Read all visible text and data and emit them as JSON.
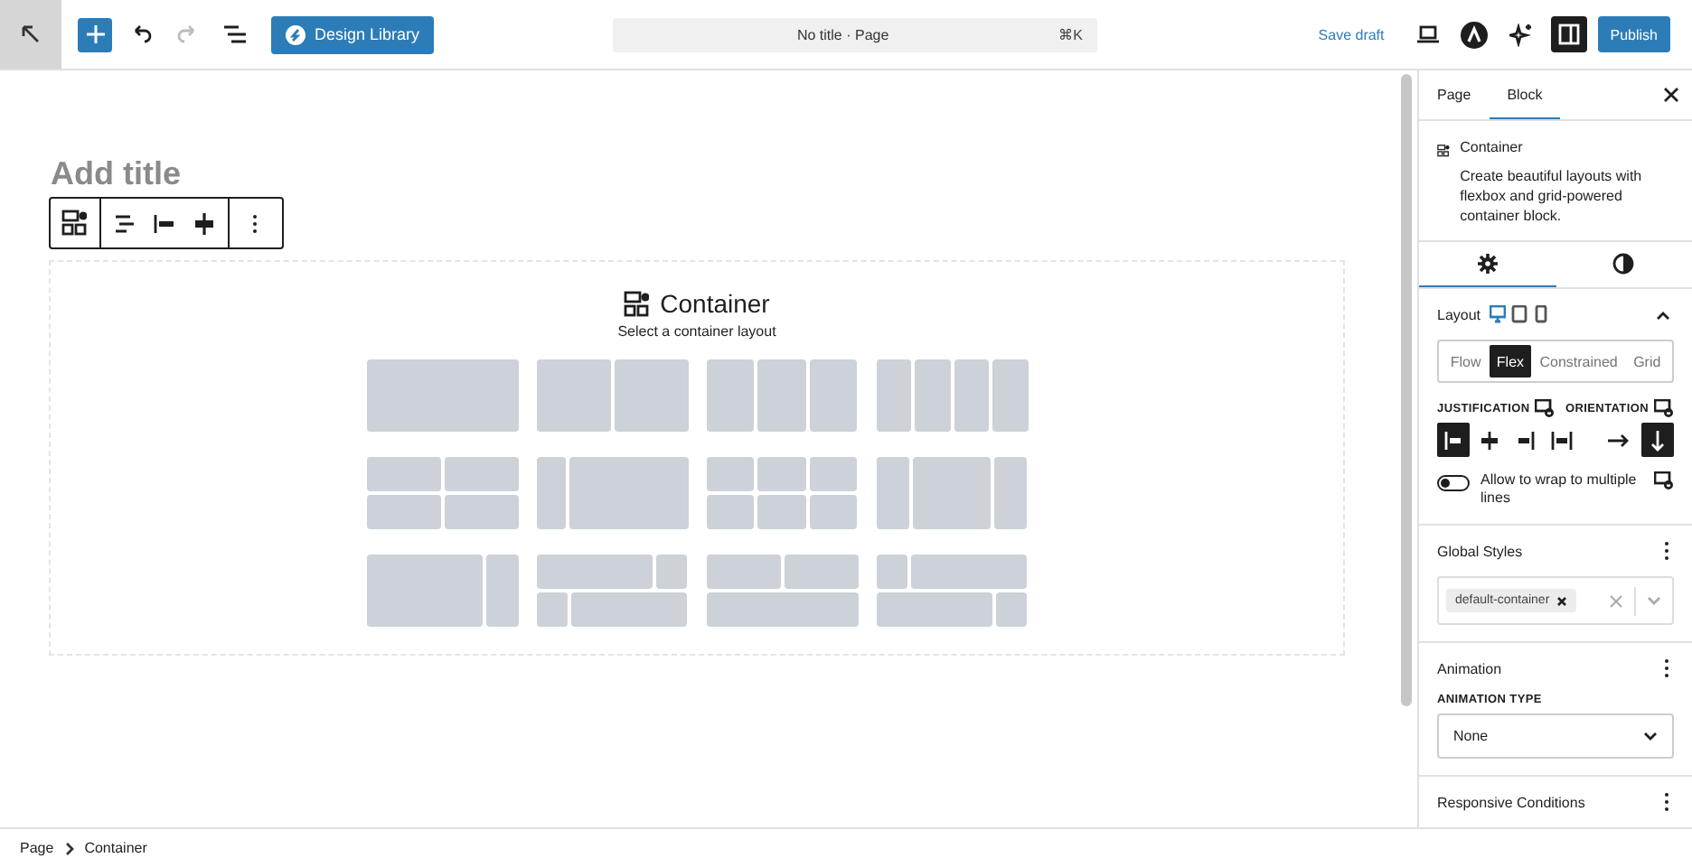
{
  "toolbar": {
    "library_button": "Design Library",
    "document_title": "No title · Page",
    "shortcut": "⌘K",
    "save_draft": "Save draft",
    "publish": "Publish",
    "settings_panel_open": true
  },
  "editor": {
    "title_placeholder": "Add title",
    "block": {
      "name": "Container",
      "hint": "Select a container layout",
      "layouts": [
        {
          "kind": "one"
        },
        {
          "kind": "halves"
        },
        {
          "kind": "thirds"
        },
        {
          "kind": "quarters"
        },
        {
          "kind": "grid4"
        },
        {
          "kind": "sidebar"
        },
        {
          "kind": "grid6"
        },
        {
          "kind": "center"
        },
        {
          "kind": "aside"
        },
        {
          "kind": "staggerA"
        },
        {
          "kind": "twoOverOne"
        },
        {
          "kind": "staggerB"
        }
      ]
    }
  },
  "breadcrumbs": [
    "Page",
    "Container"
  ],
  "sidebar": {
    "tabs": [
      {
        "label": "Page",
        "selected": false
      },
      {
        "label": "Block",
        "selected": true
      }
    ],
    "block_card": {
      "name": "Container",
      "description": "Create beautiful layouts with flexbox and grid-powered container block."
    },
    "panel_tabs": [
      {
        "kind": "settings",
        "selected": true
      },
      {
        "kind": "styles",
        "selected": false
      }
    ],
    "layout": {
      "title": "Layout",
      "devices": [
        {
          "kind": "desktop",
          "selected": true
        },
        {
          "kind": "tablet",
          "selected": false
        },
        {
          "kind": "mobile",
          "selected": false
        }
      ],
      "types": [
        {
          "label": "Flow",
          "selected": false
        },
        {
          "label": "Flex",
          "selected": true
        },
        {
          "label": "Constrained",
          "selected": false
        },
        {
          "label": "Grid",
          "selected": false
        }
      ],
      "justification_label": "JUSTIFICATION",
      "orientation_label": "ORIENTATION",
      "justification": [
        {
          "kind": "start",
          "selected": true
        },
        {
          "kind": "center",
          "selected": false
        },
        {
          "kind": "end",
          "selected": false
        },
        {
          "kind": "between",
          "selected": false
        }
      ],
      "orientation": [
        {
          "kind": "row",
          "selected": false
        },
        {
          "kind": "column",
          "selected": true
        }
      ],
      "wrap": {
        "label": "Allow to wrap to multiple lines",
        "on": false
      }
    },
    "global_styles": {
      "title": "Global Styles",
      "tags": [
        "default-container"
      ]
    },
    "animation": {
      "title": "Animation",
      "type_label": "ANIMATION TYPE",
      "value": "None"
    },
    "next_panel": {
      "title": "Responsive Conditions"
    }
  }
}
